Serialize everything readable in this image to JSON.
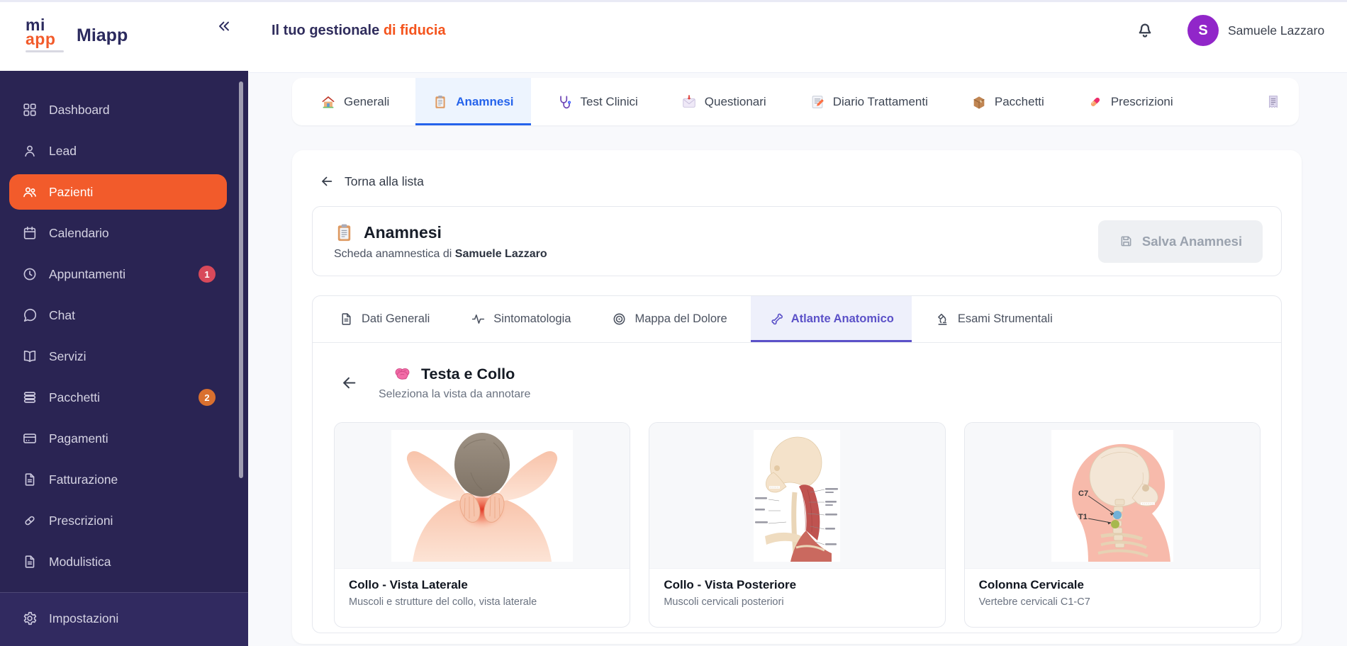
{
  "brand": {
    "logo_top": "mi",
    "logo_bottom": "app",
    "name": "Miapp"
  },
  "header": {
    "title": "Il tuo gestionale",
    "title_accent": "di fiducia",
    "user_name": "Samuele Lazzaro",
    "avatar_initial": "S"
  },
  "sidebar": {
    "items": [
      {
        "label": "Dashboard",
        "icon": "grid",
        "active": false
      },
      {
        "label": "Lead",
        "icon": "user",
        "active": false
      },
      {
        "label": "Pazienti",
        "icon": "users",
        "active": true
      },
      {
        "label": "Calendario",
        "icon": "calendar",
        "active": false
      },
      {
        "label": "Appuntamenti",
        "icon": "clock",
        "active": false,
        "badge": "1",
        "badge_color": "#d8495a"
      },
      {
        "label": "Chat",
        "icon": "chat",
        "active": false
      },
      {
        "label": "Servizi",
        "icon": "book",
        "active": false
      },
      {
        "label": "Pacchetti",
        "icon": "layers",
        "active": false,
        "badge": "2",
        "badge_color": "#d9702f"
      },
      {
        "label": "Pagamenti",
        "icon": "credit-card",
        "active": false
      },
      {
        "label": "Fatturazione",
        "icon": "file",
        "active": false
      },
      {
        "label": "Prescrizioni",
        "icon": "pill",
        "active": false
      },
      {
        "label": "Modulistica",
        "icon": "file",
        "active": false
      }
    ],
    "footer_items": [
      {
        "label": "Impostazioni",
        "icon": "gear",
        "active": false
      }
    ]
  },
  "tabs": [
    {
      "label": "Generali",
      "icon": "house",
      "active": false
    },
    {
      "label": "Anamnesi",
      "icon": "clipboard",
      "active": true
    },
    {
      "label": "Test Clinici",
      "icon": "stethoscope",
      "active": false
    },
    {
      "label": "Questionari",
      "icon": "mail",
      "active": false
    },
    {
      "label": "Diario Trattamenti",
      "icon": "memo",
      "active": false
    },
    {
      "label": "Pacchetti",
      "icon": "package",
      "active": false
    },
    {
      "label": "Prescrizioni",
      "icon": "pill-color",
      "active": false
    },
    {
      "label": "",
      "icon": "receipt",
      "active": false,
      "partial": true
    }
  ],
  "content": {
    "back_link": "Torna alla lista",
    "panel": {
      "title": "Anamnesi",
      "subtitle_prefix": "Scheda anamnestica di",
      "patient_name": "Samuele Lazzaro",
      "save_button": "Salva Anamnesi"
    },
    "subtabs": [
      {
        "label": "Dati Generali",
        "icon": "file-text",
        "active": false
      },
      {
        "label": "Sintomatologia",
        "icon": "activity",
        "active": false
      },
      {
        "label": "Mappa del Dolore",
        "icon": "target",
        "active": false
      },
      {
        "label": "Atlante Anatomico",
        "icon": "bone",
        "active": true
      },
      {
        "label": "Esami Strumentali",
        "icon": "microscope",
        "active": false
      }
    ],
    "atlas": {
      "title": "Testa e Collo",
      "subtitle": "Seleziona la vista da annotare",
      "cards": [
        {
          "title": "Collo - Vista Laterale",
          "description": "Muscoli e strutture del collo, vista laterale",
          "illustration": "neck-lateral"
        },
        {
          "title": "Collo - Vista Posteriore",
          "description": "Muscoli cervicali posteriori",
          "illustration": "neck-posterior"
        },
        {
          "title": "Colonna Cervicale",
          "description": "Vertebre cervicali C1-C7",
          "illustration": "cervical-spine",
          "labels": [
            "C7",
            "T1"
          ]
        }
      ]
    }
  },
  "colors": {
    "accent_orange": "#f25b2b",
    "header_accent": "#f4541d",
    "primary_blue": "#2563eb",
    "active_purple": "#5b51c8",
    "sidebar_bg": "#2a2453",
    "badge_red": "#d8495a",
    "badge_orange": "#d9702f",
    "avatar_purple": "#9126c9"
  }
}
